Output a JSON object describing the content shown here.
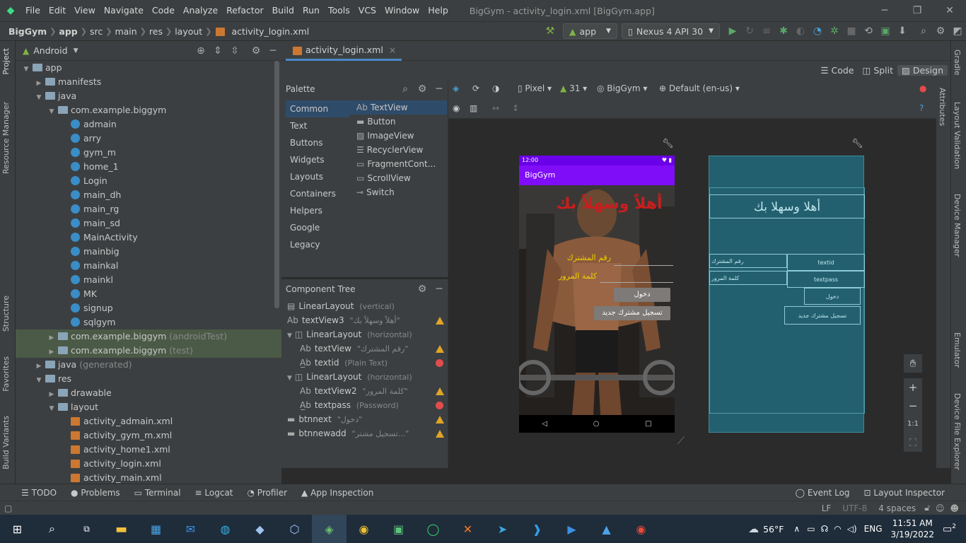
{
  "menu": [
    "File",
    "Edit",
    "View",
    "Navigate",
    "Code",
    "Analyze",
    "Refactor",
    "Build",
    "Run",
    "Tools",
    "VCS",
    "Window",
    "Help"
  ],
  "window_title": "BigGym - activity_login.xml [BigGym.app]",
  "breadcrumb": [
    "BigGym",
    "app",
    "src",
    "main",
    "res",
    "layout",
    "activity_login.xml"
  ],
  "toolbar": {
    "module": "app",
    "device": "Nexus 4 API 30"
  },
  "project_panel": {
    "view": "Android",
    "tree": [
      {
        "label": "app",
        "indent": 0,
        "type": "folder",
        "open": true
      },
      {
        "label": "manifests",
        "indent": 1,
        "type": "folder",
        "open": false
      },
      {
        "label": "java",
        "indent": 1,
        "type": "folder",
        "open": true
      },
      {
        "label": "com.example.biggym",
        "indent": 2,
        "type": "folder",
        "open": true
      },
      {
        "label": "admain",
        "indent": 3,
        "type": "class"
      },
      {
        "label": "arry",
        "indent": 3,
        "type": "class"
      },
      {
        "label": "gym_m",
        "indent": 3,
        "type": "class"
      },
      {
        "label": "home_1",
        "indent": 3,
        "type": "class"
      },
      {
        "label": "Login",
        "indent": 3,
        "type": "class"
      },
      {
        "label": "main_dh",
        "indent": 3,
        "type": "class"
      },
      {
        "label": "main_rg",
        "indent": 3,
        "type": "class"
      },
      {
        "label": "main_sd",
        "indent": 3,
        "type": "class"
      },
      {
        "label": "MainActivity",
        "indent": 3,
        "type": "class"
      },
      {
        "label": "mainbig",
        "indent": 3,
        "type": "class"
      },
      {
        "label": "mainkal",
        "indent": 3,
        "type": "class"
      },
      {
        "label": "mainkl",
        "indent": 3,
        "type": "class"
      },
      {
        "label": "MK",
        "indent": 3,
        "type": "class"
      },
      {
        "label": "signup",
        "indent": 3,
        "type": "class"
      },
      {
        "label": "sqlgym",
        "indent": 3,
        "type": "class"
      },
      {
        "label": "com.example.biggym",
        "suffix": "(androidTest)",
        "indent": 2,
        "type": "folder",
        "open": false,
        "hl": true
      },
      {
        "label": "com.example.biggym",
        "suffix": "(test)",
        "indent": 2,
        "type": "folder",
        "open": false,
        "hl": true
      },
      {
        "label": "java",
        "suffix": "(generated)",
        "indent": 1,
        "type": "folder",
        "open": false
      },
      {
        "label": "res",
        "indent": 1,
        "type": "folder",
        "open": true
      },
      {
        "label": "drawable",
        "indent": 2,
        "type": "folder",
        "open": false
      },
      {
        "label": "layout",
        "indent": 2,
        "type": "folder",
        "open": true
      },
      {
        "label": "activity_admain.xml",
        "indent": 3,
        "type": "xml"
      },
      {
        "label": "activity_gym_m.xml",
        "indent": 3,
        "type": "xml"
      },
      {
        "label": "activity_home1.xml",
        "indent": 3,
        "type": "xml"
      },
      {
        "label": "activity_login.xml",
        "indent": 3,
        "type": "xml"
      },
      {
        "label": "activity_main.xml",
        "indent": 3,
        "type": "xml"
      }
    ]
  },
  "editor_tab": "activity_login.xml",
  "view_modes": {
    "code": "Code",
    "split": "Split",
    "design": "Design"
  },
  "palette": {
    "title": "Palette",
    "categories": [
      "Common",
      "Text",
      "Buttons",
      "Widgets",
      "Layouts",
      "Containers",
      "Helpers",
      "Google",
      "Legacy"
    ],
    "items": [
      "TextView",
      "Button",
      "ImageView",
      "RecyclerView",
      "FragmentCont...",
      "ScrollView",
      "Switch"
    ]
  },
  "component_tree": {
    "title": "Component Tree",
    "rows": [
      {
        "name": "LinearLayout",
        "hint": "(vertical)",
        "indent": 0,
        "flag": ""
      },
      {
        "name": "textView3",
        "hint": "\"أهلاً وسهلاً بك\"",
        "indent": 0,
        "flag": "warn"
      },
      {
        "name": "LinearLayout",
        "hint": "(horizontal)",
        "indent": 0,
        "flag": ""
      },
      {
        "name": "textView",
        "hint": "\"رقم المشترك\"",
        "indent": 1,
        "flag": "warn"
      },
      {
        "name": "textid",
        "hint": "(Plain Text)",
        "indent": 1,
        "flag": "err"
      },
      {
        "name": "LinearLayout",
        "hint": "(horizontal)",
        "indent": 0,
        "flag": ""
      },
      {
        "name": "textView2",
        "hint": "\"كلمة المرور\"",
        "indent": 1,
        "flag": "warn"
      },
      {
        "name": "textpass",
        "hint": "(Password)",
        "indent": 1,
        "flag": "err"
      },
      {
        "name": "btnnext",
        "hint": "\"دخول\"",
        "indent": 0,
        "flag": "warn"
      },
      {
        "name": "btnnewadd",
        "hint": "\"تسجيل مشتر...\"",
        "indent": 0,
        "flag": "warn"
      }
    ]
  },
  "design_toolbar": {
    "device": "Pixel",
    "api": "31",
    "theme": "BigGym",
    "locale": "Default (en-us)"
  },
  "phone": {
    "time": "12:00",
    "app_title": "BigGym",
    "welcome": "أهلاً وسهلاً بك",
    "member_label": "رقم المشترك",
    "password_label": "كلمة المرور",
    "login_button": "دخول",
    "register_button": "تسجيل مشترك جديد"
  },
  "blueprint": {
    "welcome": "أهلا وسهلا بك",
    "textid": "textid",
    "textpass": "textpass",
    "member_label": "رقم المشترك",
    "password_label": "كلمة المرور",
    "login_button": "دخول",
    "register_button": "تسجيل مشترك جديد"
  },
  "zoom": {
    "ratio": "1:1"
  },
  "right_tabs": [
    "Gradle",
    "Attributes",
    "Layout Validation",
    "Device Manager",
    "Emulator",
    "Device File Explorer"
  ],
  "left_tabs": [
    "Project",
    "Resource Manager",
    "Structure",
    "Favorites",
    "Build Variants"
  ],
  "bottom_tools": [
    "TODO",
    "Problems",
    "Terminal",
    "Logcat",
    "Profiler",
    "App Inspection"
  ],
  "bottom_right_tools": [
    "Event Log",
    "Layout Inspector"
  ],
  "status": {
    "line_sep": "LF",
    "encoding": "UTF-8",
    "indent": "4 spaces"
  },
  "taskbar": {
    "weather": "56°F",
    "lang": "ENG",
    "time": "11:51 AM",
    "date": "3/19/2022",
    "notifications": "2"
  },
  "colors": {
    "ide_bg": "#3c3f41",
    "editor_bg": "#2b2b2b",
    "accent": "#4a88c7",
    "app_primary": "#7f0df7",
    "warning": "#e0a526",
    "error": "#e34c4c"
  }
}
